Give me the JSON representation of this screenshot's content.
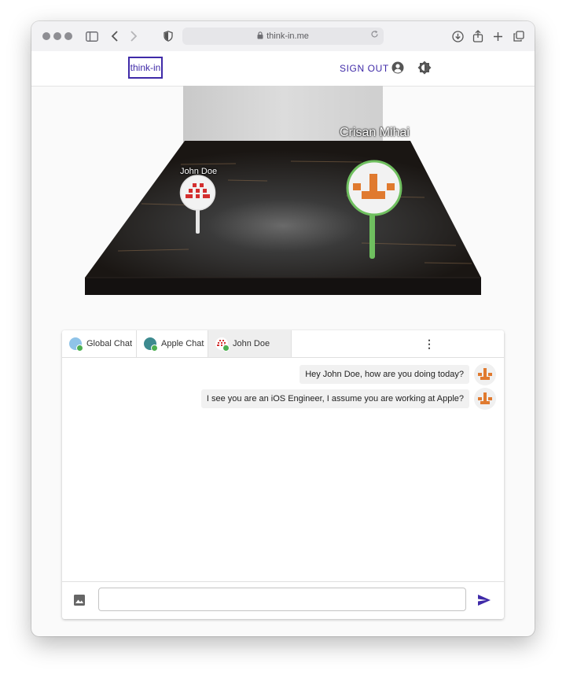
{
  "browser": {
    "url": "think-in.me"
  },
  "header": {
    "logo_text": "think-in",
    "signout_label": "SIGN OUT",
    "accent_color": "#3f2aa8"
  },
  "scene": {
    "players": [
      {
        "name": "John Doe",
        "ring_color": "#ffffff",
        "face_color": "#d32f2f"
      },
      {
        "name": "Crisan Mihai",
        "ring_color": "#6fbf5f",
        "face_color": "#e07a2f"
      }
    ]
  },
  "chat": {
    "tabs": [
      {
        "label": "Global Chat",
        "avatar_color": "#8fc3e8",
        "online": true
      },
      {
        "label": "Apple Chat",
        "avatar_color": "#3d8a8f",
        "online": true
      },
      {
        "label": "John Doe",
        "avatar": "pixel-face-red",
        "online": true,
        "active": true
      }
    ],
    "messages": [
      {
        "text": "Hey John Doe, how are you doing today?",
        "sender_avatar": "pixel-face-orange"
      },
      {
        "text": "I see you are an iOS Engineer, I assume you are working at Apple?",
        "sender_avatar": "pixel-face-orange"
      }
    ],
    "composer": {
      "placeholder": "",
      "value": ""
    }
  }
}
